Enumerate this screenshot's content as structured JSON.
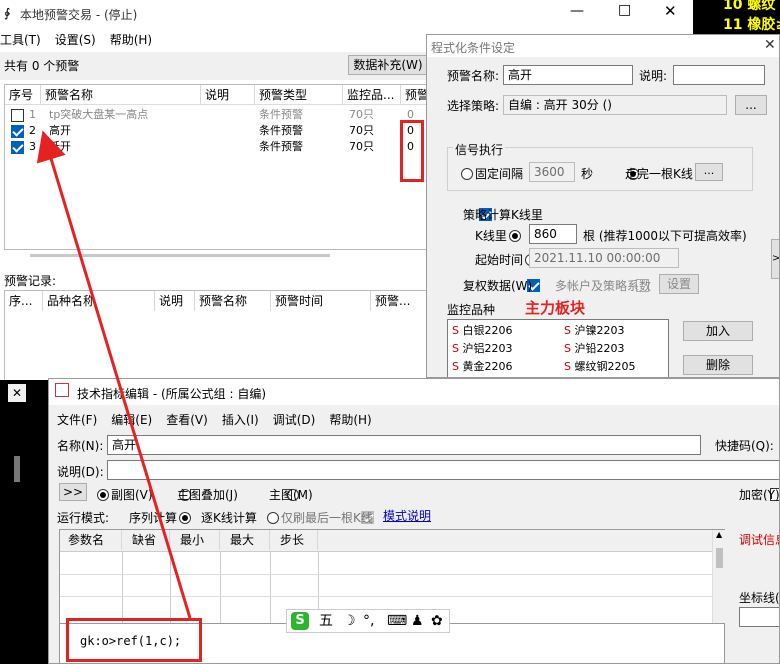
{
  "top_right": {
    "row1": "10  螺纹",
    "row2": "11  橡胶≥"
  },
  "main_window": {
    "title": "本地预警交易 - (停止)",
    "menu": [
      "工具(T)",
      "设置(S)",
      "帮助(H)"
    ],
    "summary": "共有 0 个预警",
    "supplement_button": "数据补充(W)",
    "table_headers": [
      "序号",
      "预警名称",
      "说明",
      "预警类型",
      "监控品...",
      "预警"
    ],
    "rows": [
      {
        "checked": false,
        "index": "1",
        "name": "tp突破大盘某一高点",
        "desc": "",
        "type": "条件预警",
        "monitor": "70只",
        "warn": "0"
      },
      {
        "checked": true,
        "index": "2",
        "name": "高开",
        "desc": "",
        "type": "条件预警",
        "monitor": "70只",
        "warn": "0"
      },
      {
        "checked": true,
        "index": "3",
        "name": "低开",
        "desc": "",
        "type": "条件预警",
        "monitor": "70只",
        "warn": "0"
      }
    ],
    "records_label": "预警记录:",
    "record_headers": [
      "序...",
      "品种名称",
      "说明",
      "预警名称",
      "预警时间",
      "预警..."
    ]
  },
  "cond_dialog": {
    "title": "程式化条件设定",
    "name_label": "预警名称:",
    "name_value": "高开",
    "desc_label": "说明:",
    "desc_value": "",
    "strategy_label": "选择策略:",
    "strategy_value": "自编 : 高开 30分 ()",
    "browse": "...",
    "signal_group": "信号执行",
    "fixed_interval": "固定间隔",
    "interval_value": "3600",
    "sec": "秒",
    "after_bar": "走完一根K线",
    "after_bar_btn": "...",
    "calc_kline": "策略计算K线里",
    "kline_count_label": "K线里",
    "kline_count": "860",
    "kline_tip": "根 (推荐1000以下可提高效率)",
    "start_time_label": "起始时间",
    "start_time": "2021.11.10 00:00:00",
    "fuquan": "复权数据(W)",
    "multi_account": "多帐户及策略系数",
    "settings_btn": "设置",
    "monitor_label": "监控品种",
    "annotation": "主力板块",
    "symbols_left": [
      "白银2206",
      "沪铝2203",
      "黄金2206"
    ],
    "symbols_right": [
      "沪镍2203",
      "沪铅2203",
      "螺纹钢2205"
    ],
    "symbol_prefix": "S",
    "add_btn": "加入",
    "del_btn": "删除",
    "side_btn": ">>"
  },
  "formula_editor": {
    "title": "技术指标编辑 - (所属公式组 : 自编)",
    "menu": [
      "文件(F)",
      "编辑(E)",
      "查看(V)",
      "插入(I)",
      "调试(D)",
      "帮助(H)"
    ],
    "name_label": "名称(N):",
    "name_value": "高开",
    "shortcut_label": "快捷码(Q):",
    "desc_label": "说明(D):",
    "expand_btn": ">>",
    "opt_sub": "副图(V)",
    "opt_overlay": "主图叠加(J)",
    "opt_main": "主图(M)",
    "encrypt": "加密(Y)",
    "run_mode": "运行模式:",
    "seq_calc": "序列计算",
    "bar_calc": "逐K线计算",
    "last_only": "仅刷最后一根K线",
    "mode_link": "模式说明",
    "param_headers": [
      "参数名",
      "缺省",
      "最小",
      "最大",
      "步长"
    ],
    "debug_label": "调试信息",
    "axis_label": "坐标线(",
    "code": "gk:o>ref(1,c);"
  },
  "ime_bar": {
    "logo": "S",
    "wu": "五",
    "moon": "☽",
    "punct": "°,",
    "keyboard": "⌨",
    "user": "♟",
    "grid": "✿"
  },
  "colors": {
    "annotation_red": "#e52222",
    "accent_blue": "#0060c0",
    "symbol_red": "#cc0000"
  }
}
